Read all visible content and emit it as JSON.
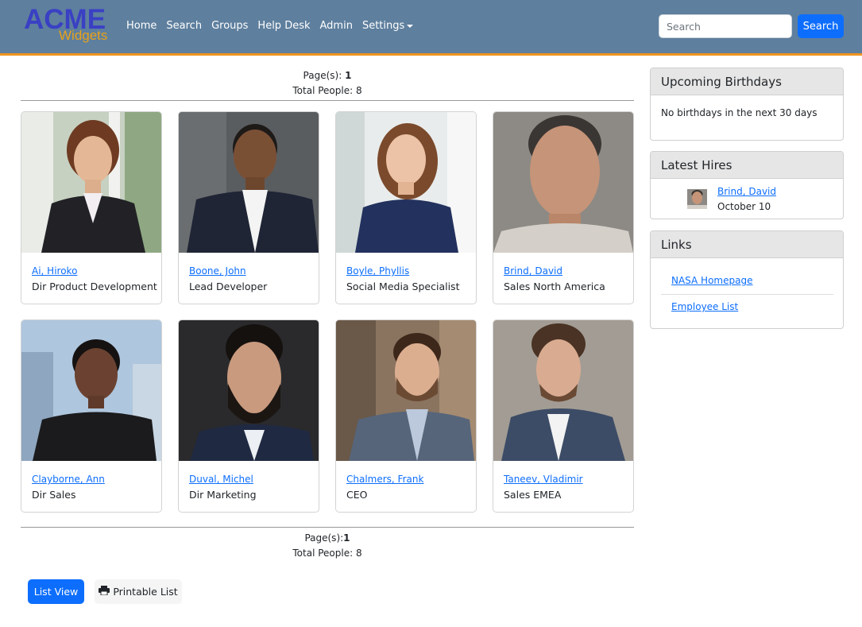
{
  "brand": {
    "name": "ACME",
    "tagline": "Widgets",
    "primary_color": "#3a40c4",
    "accent_color": "#e8a21a"
  },
  "nav": {
    "items": [
      {
        "label": "Home"
      },
      {
        "label": "Search"
      },
      {
        "label": "Groups"
      },
      {
        "label": "Help Desk"
      },
      {
        "label": "Admin"
      },
      {
        "label": "Settings",
        "has_dropdown": true
      }
    ],
    "search_placeholder": "Search",
    "search_button": "Search",
    "bar_color": "#5e7f9e",
    "border_color": "#f0941f"
  },
  "paging": {
    "top": {
      "pages_label": "Page(s):",
      "pages_value": "1",
      "total_label": "Total People: 8"
    },
    "bottom": {
      "pages_label": "Page(s):",
      "pages_value": "1",
      "total_label": "Total People: 8"
    }
  },
  "people": [
    {
      "name": "Ai, Hiroko",
      "title": "Dir Product Development",
      "photo_icon": "person-photo"
    },
    {
      "name": "Boone, John",
      "title": "Lead Developer",
      "photo_icon": "person-photo"
    },
    {
      "name": "Boyle, Phyllis",
      "title": "Social Media Specialist",
      "photo_icon": "person-photo"
    },
    {
      "name": "Brind, David",
      "title": "Sales North America",
      "photo_icon": "person-photo"
    },
    {
      "name": "Clayborne, Ann",
      "title": "Dir Sales",
      "photo_icon": "person-photo"
    },
    {
      "name": "Duval, Michel",
      "title": "Dir Marketing",
      "photo_icon": "person-photo"
    },
    {
      "name": "Chalmers, Frank",
      "title": "CEO",
      "photo_icon": "person-photo"
    },
    {
      "name": "Taneev, Vladimir",
      "title": "Sales EMEA",
      "photo_icon": "person-photo"
    }
  ],
  "sidebar": {
    "birthdays": {
      "title": "Upcoming Birthdays",
      "text": "No birthdays in the next 30 days"
    },
    "hires": {
      "title": "Latest Hires",
      "items": [
        {
          "name": "Brind, David",
          "date": "October 10"
        }
      ]
    },
    "links": {
      "title": "Links",
      "items": [
        {
          "label": "NASA Homepage"
        },
        {
          "label": "Employee List"
        }
      ]
    }
  },
  "actions": {
    "list_view": "List View",
    "printable_list": "Printable List",
    "print_icon": "printer-icon"
  }
}
